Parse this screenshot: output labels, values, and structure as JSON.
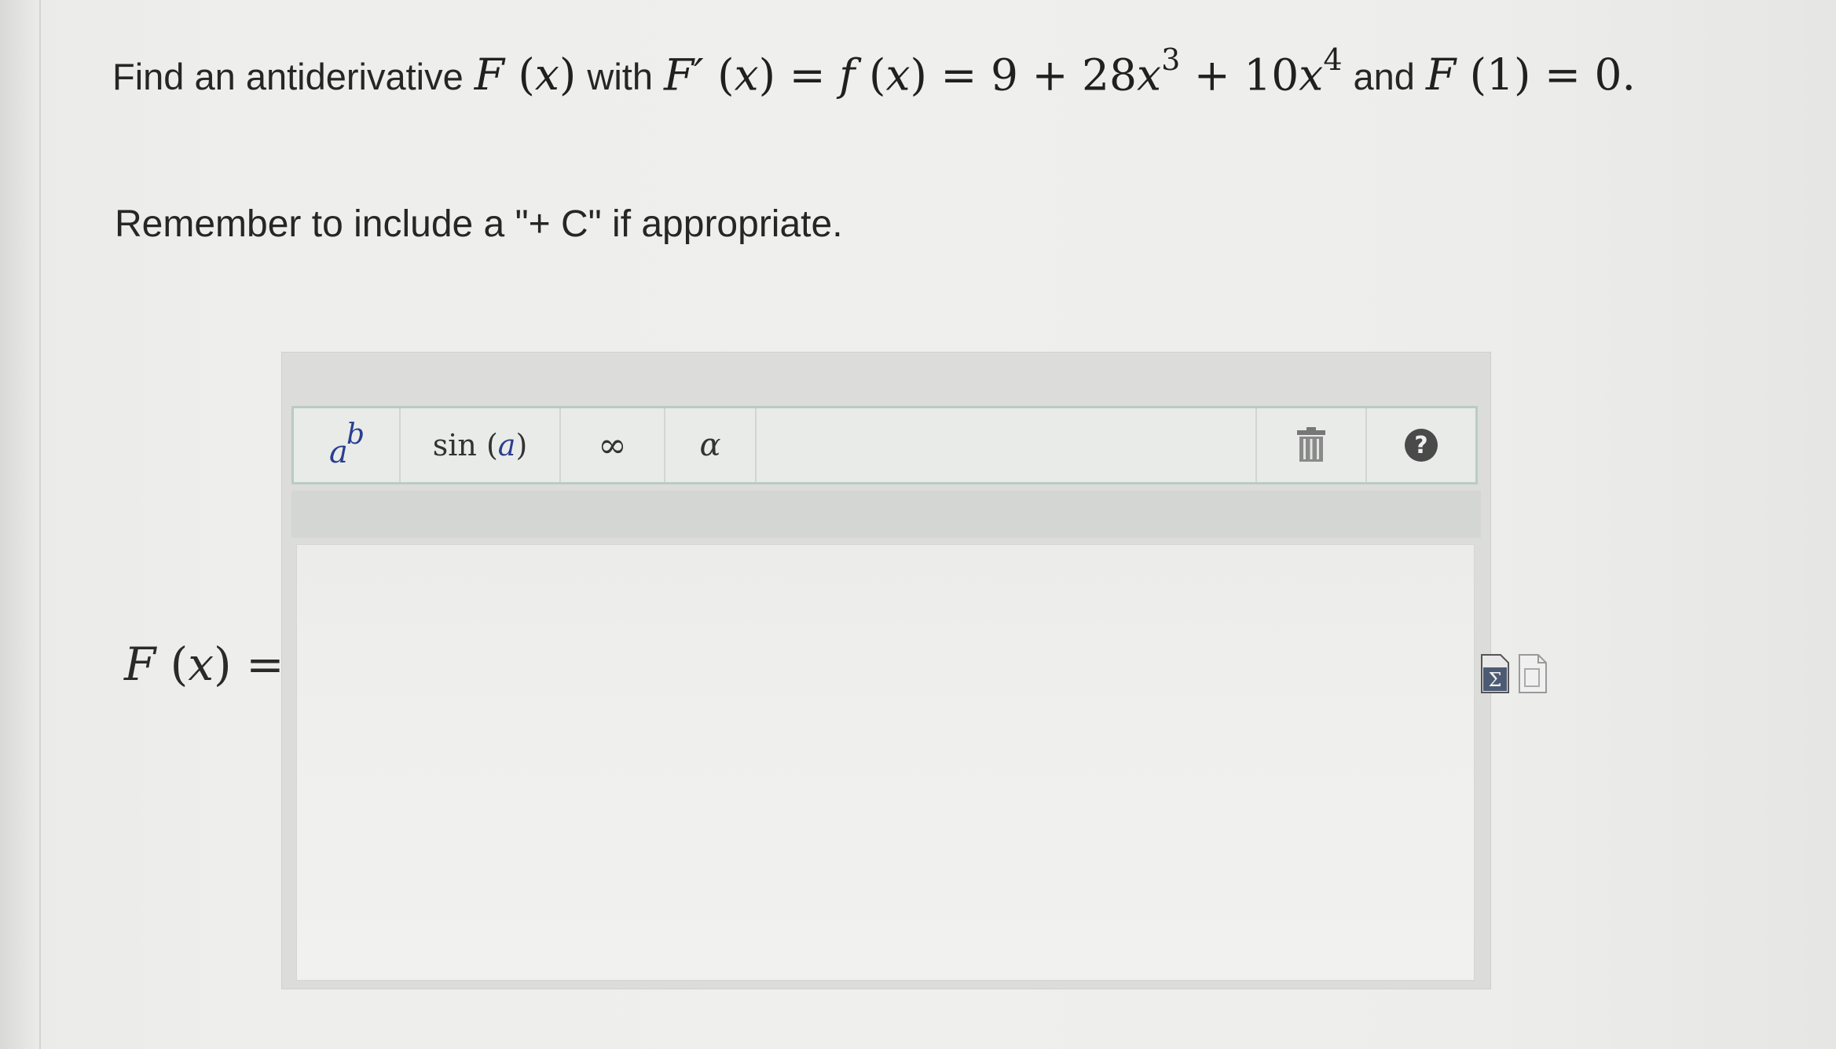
{
  "question": {
    "prefix": "Find an antiderivative",
    "with_word": "with",
    "and_word": "and",
    "fx_name": "F",
    "var": "x",
    "deriv_name": "F′",
    "f_name": "f",
    "equals": "=",
    "expr_const": "9 + 28",
    "exp1": "3",
    "expr_mid": " + 10",
    "exp2": "4",
    "cond": "F(1) = 0.",
    "remember": "Remember to include a \"+ C\" if appropriate."
  },
  "answer": {
    "label": "F(x) =",
    "value": ""
  },
  "toolbar": {
    "power_a": "a",
    "power_b": "b",
    "sin_label": "sin",
    "sin_arg": "a",
    "infinity": "∞",
    "alpha": "α",
    "help": "?"
  },
  "icons": {
    "power": "superscript-icon",
    "trash": "trash-icon",
    "help": "help-icon",
    "equation": "equation-editor-icon",
    "preview": "preview-doc-icon"
  },
  "colors": {
    "toolbar_border": "#b9ccc4",
    "math_accent": "#2b3e8f"
  }
}
